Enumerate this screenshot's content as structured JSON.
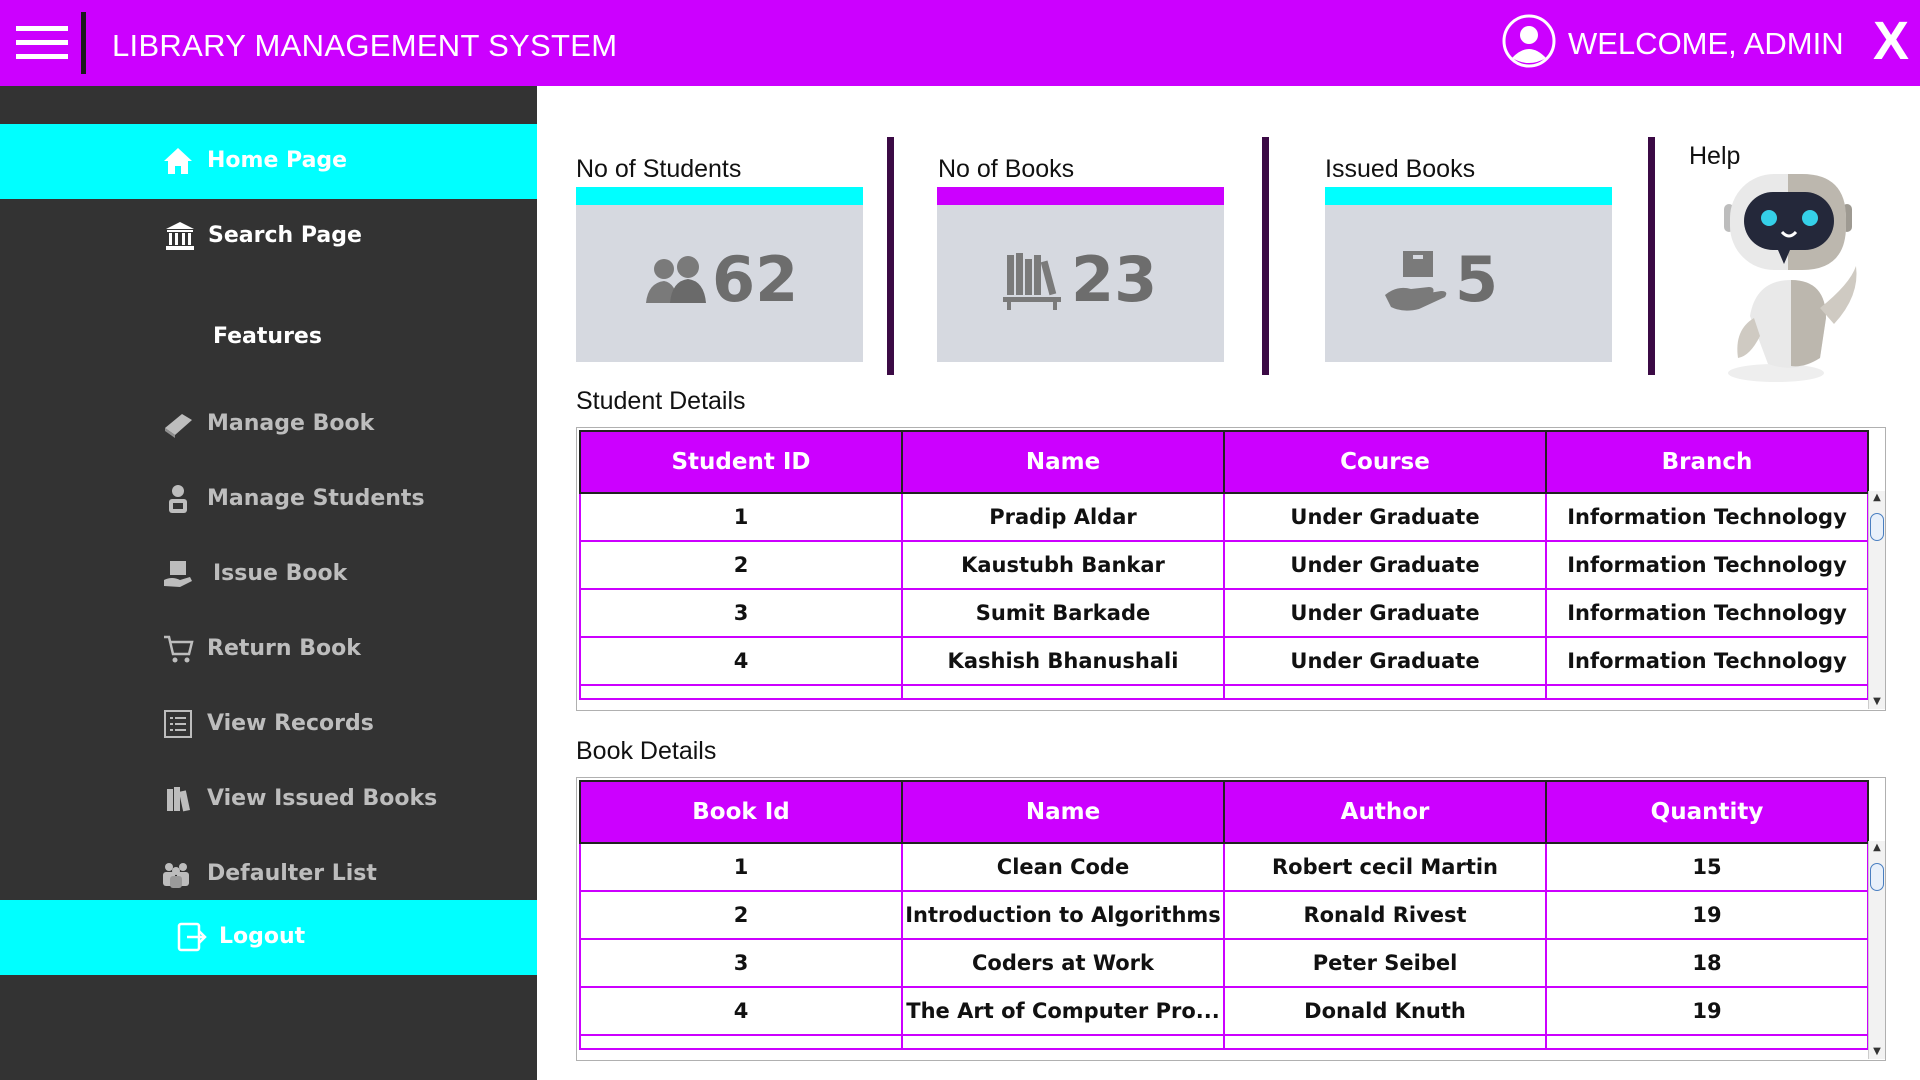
{
  "header": {
    "title": "LIBRARY MANAGEMENT SYSTEM",
    "welcome": "WELCOME, ADMIN",
    "close_label": "X",
    "accent": "#cc00ff"
  },
  "sidebar": {
    "items": [
      {
        "label": "Home Page",
        "icon": "home-icon",
        "active": true
      },
      {
        "label": "Search Page",
        "icon": "library-icon"
      },
      {
        "label": "Manage Book",
        "icon": "book-icon"
      },
      {
        "label": "Manage Students",
        "icon": "student-icon"
      },
      {
        "label": "Issue Book",
        "icon": "issue-book-icon"
      },
      {
        "label": "Return Book",
        "icon": "cart-icon"
      },
      {
        "label": "View Records",
        "icon": "list-icon"
      },
      {
        "label": "View Issued Books",
        "icon": "books-icon"
      },
      {
        "label": "Defaulter List",
        "icon": "group-icon"
      },
      {
        "label": "Logout",
        "icon": "logout-icon",
        "active": true
      }
    ],
    "features_title": "Features",
    "active_color": "#00ffff",
    "bg_color": "#333333"
  },
  "stats": [
    {
      "label": "No of Students",
      "value": "62",
      "bar_color": "#00ffff",
      "icon": "users-icon"
    },
    {
      "label": "No of Books",
      "value": "23",
      "bar_color": "#cc00ff",
      "icon": "bookshelf-icon"
    },
    {
      "label": "Issued Books",
      "value": "5",
      "bar_color": "#00ffff",
      "icon": "hand-box-icon"
    }
  ],
  "help": {
    "label": "Help",
    "icon": "robot-icon"
  },
  "students": {
    "title": "Student Details",
    "columns": [
      "Student ID",
      "Name",
      "Course",
      "Branch"
    ],
    "rows": [
      [
        "1",
        "Pradip Aldar",
        "Under Graduate",
        "Information Technology"
      ],
      [
        "2",
        "Kaustubh Bankar",
        "Under Graduate",
        "Information Technology"
      ],
      [
        "3",
        "Sumit Barkade",
        "Under Graduate",
        "Information Technology"
      ],
      [
        "4",
        "Kashish Bhanushali",
        "Under Graduate",
        "Information Technology"
      ]
    ]
  },
  "books": {
    "title": "Book Details",
    "columns": [
      "Book Id",
      "Name",
      "Author",
      "Quantity"
    ],
    "rows": [
      [
        "1",
        "Clean Code",
        "Robert cecil Martin",
        "15"
      ],
      [
        "2",
        "Introduction to Algorithms",
        "Ronald Rivest",
        "19"
      ],
      [
        "3",
        "Coders at Work",
        "Peter Seibel",
        "18"
      ],
      [
        "4",
        "The Art of Computer Pro...",
        "Donald Knuth",
        "19"
      ]
    ]
  }
}
